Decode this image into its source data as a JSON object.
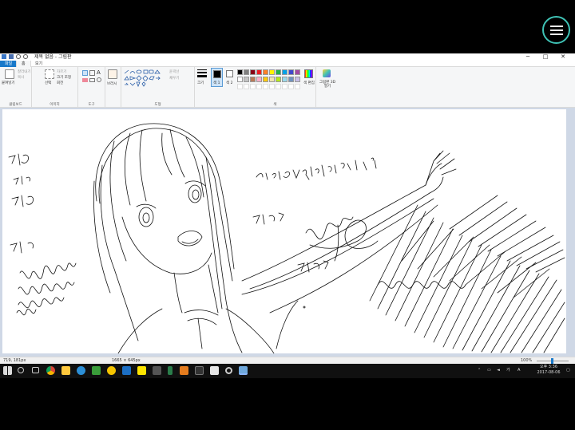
{
  "overlay": {
    "menu_icon": "hamburger-icon",
    "accent": "#3fc2b5"
  },
  "window": {
    "title": "제목 없음 - 그림판",
    "controls": [
      "─",
      "□",
      "✕"
    ]
  },
  "tabs": {
    "file": "파일",
    "home": "홈",
    "view": "보기"
  },
  "ribbon": {
    "clipboard": {
      "paste": "붙여넣기",
      "cut": "잘라내기",
      "copy": "복사",
      "label": "클립보드"
    },
    "image": {
      "select": "선택",
      "crop": "자르기",
      "resize": "크기 조정",
      "rotate": "회전",
      "label": "이미지"
    },
    "tools": {
      "label": "도구"
    },
    "brushes": {
      "label": "브러시"
    },
    "shapes": {
      "outline": "윤곽선",
      "fill": "채우기",
      "label": "도형"
    },
    "size": {
      "label": "크기"
    },
    "color1": {
      "label": "색 1"
    },
    "color2": {
      "label": "색 2"
    },
    "edit_colors": {
      "label": "색 편집"
    },
    "paint3d": {
      "label": "그림판 3D 열기"
    },
    "colors_label": "색",
    "palette": [
      "#000000",
      "#7f7f7f",
      "#880015",
      "#ed1c24",
      "#ff7f27",
      "#fff200",
      "#22b14c",
      "#00a2e8",
      "#3f48cc",
      "#a349a4",
      "#ffffff",
      "#c3c3c3",
      "#b97a57",
      "#ffaec9",
      "#ffc90e",
      "#efe4b0",
      "#b5e61d",
      "#99d9ea",
      "#7092be",
      "#c8bfe7"
    ]
  },
  "status": {
    "cursor": "719, 181px",
    "size": "1665 × 645px",
    "zoom": "100%"
  },
  "taskbar": {
    "time": "오후 3:36",
    "date": "2017-08-06",
    "lang": "A",
    "ime": "가"
  }
}
